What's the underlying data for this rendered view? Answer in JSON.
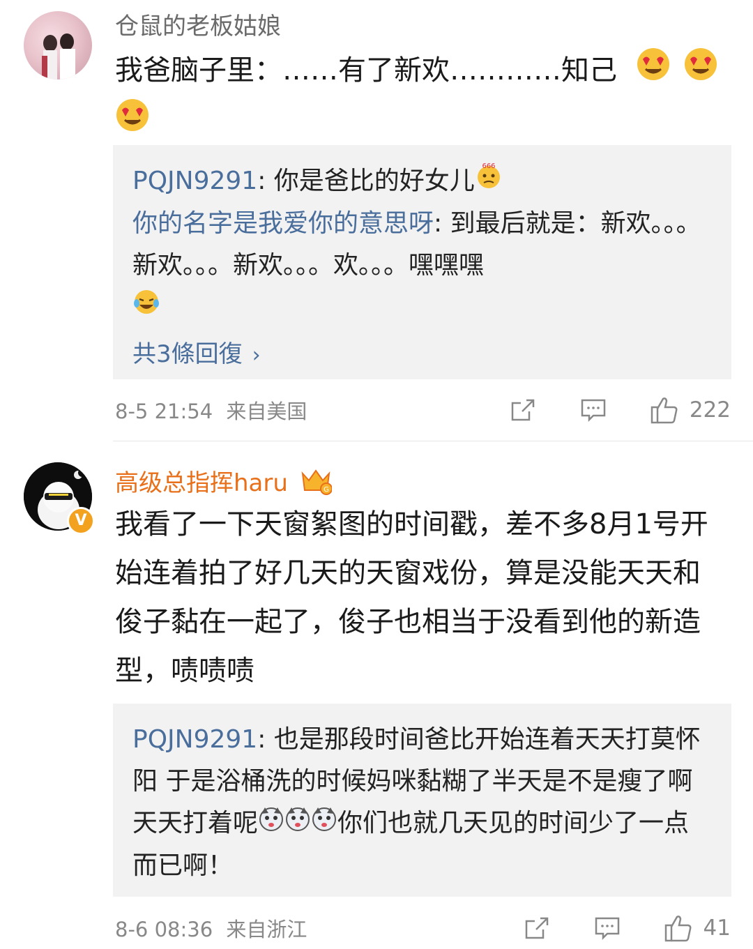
{
  "comments": [
    {
      "username": "仓鼠的老板姑娘",
      "text": "我爸脑子里：……有了新欢…………知己",
      "replies": [
        {
          "name": "PQJN9291",
          "text": "你是爸比的好女儿"
        },
        {
          "name": "你的名字是我爱你的意思呀",
          "text": "到最后就是：新欢。。。新欢。。。新欢。。。欢。。。嘿嘿嘿"
        }
      ],
      "more_replies": "共3條回復",
      "time": "8-5 21:54",
      "location": "来自美国",
      "likes": "222"
    },
    {
      "username": "高级总指挥haru",
      "avatar_badge": "V",
      "text": "我看了一下天窗絮图的时间戳，差不多8月1号开始连着拍了好几天的天窗戏份，算是没能天天和俊子黏在一起了，俊子也相当于没看到他的新造型，啧啧啧",
      "replies": [
        {
          "name": "PQJN9291",
          "text_a": "也是那段时间爸比开始连着天天打莫怀阳 于是浴桶洗的时候妈咪黏糊了半天是不是瘦了啊天天打着呢",
          "text_b": "你们也就几天见的时间少了一点而已啊！"
        }
      ],
      "time": "8-6 08:36",
      "location": "来自浙江",
      "likes": "41"
    }
  ],
  "icons": [
    "share-icon",
    "comment-icon",
    "like-icon",
    "heart-eyes-emoji",
    "laughing-emoji",
    "husky-emoji",
    "crown-icon"
  ],
  "colors": {
    "username_vip": "#e8701a",
    "reply_name": "#4a6e9c",
    "meta": "#888888",
    "reply_bg": "#f2f2f2"
  }
}
